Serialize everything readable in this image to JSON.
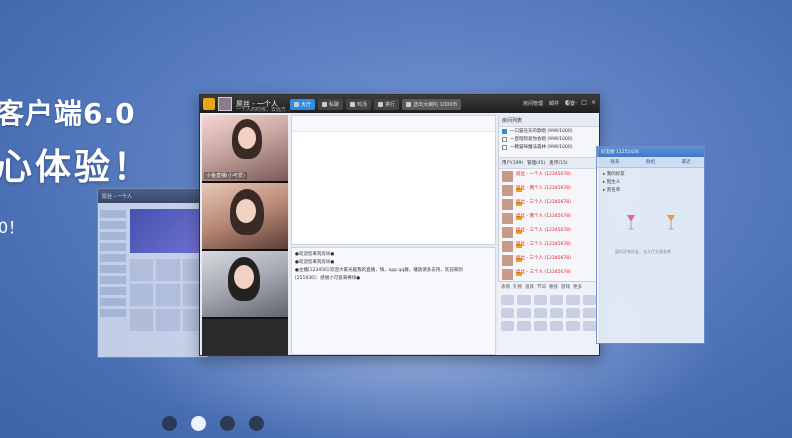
{
  "banner": {
    "headline": "客户端6.0",
    "sub_headline": "心体验！",
    "tagline": "0！"
  },
  "main_window": {
    "user_name": "屌丝 - 一个人",
    "user_desc": "一个人的时候，去远方...",
    "tabs": [
      {
        "label": "大厅",
        "active": true
      },
      {
        "label": "私聊",
        "active": false
      },
      {
        "label": "鸡汤",
        "active": false
      },
      {
        "label": "排行",
        "active": false
      },
      {
        "label": "送出大喇叭 1000币",
        "active": false
      }
    ],
    "top_links": [
      "房间管理",
      "邮件",
      "设置"
    ],
    "video_caption": "小鱼直播(小可爱)",
    "chat_log": [
      "●欢迎您来到房间●",
      "●欢迎您来到房间●",
      "●主播[123456]:欢迎大家光临我的直播，嗨，app qq群，播放请多支持，欢迎来到",
      "[251936]：感谢小可爱来捧场●"
    ],
    "song_list_title": "房间列表",
    "songs": [
      {
        "label": "一口猫任东的歌唱 (999/1000)",
        "checked": true
      },
      {
        "label": "一直暗暗爱你会唱 (999/1000)",
        "checked": false
      },
      {
        "label": "一颗猫咪魔法森林 (999/1000)",
        "checked": false
      }
    ],
    "user_list_tabs": [
      "用户(199)",
      "管理(45)",
      "麦序(15)"
    ],
    "users": [
      "屌丝 - 一个人 (12345678)",
      "屌丝 - 两个人 (12345678)",
      "屌丝 - 三个人 (12345678)",
      "屌丝 - 两个人 (12345678)",
      "屌丝 - 三个人 (12345678)",
      "屌丝 - 三个人 (12345678)",
      "屌丝 - 三个人 (12345678)",
      "屌丝 - 三个人 (12345678)"
    ],
    "emoji_tabs": [
      "表情",
      "礼物",
      "道具",
      "节日",
      "奢侈",
      "游戏",
      "更多"
    ]
  },
  "left_window": {
    "title": "屌丝 - 一个人"
  },
  "right_window": {
    "title": "好友圈 11255434",
    "tabs": [
      "联系",
      "群组",
      "最近"
    ],
    "groups": [
      "我的好友",
      "陌生人",
      "黑名单"
    ],
    "empty_message": "暂时没有好友，去大厅交朋友吧"
  },
  "carousel": {
    "count": 4,
    "active_index": 1
  },
  "colors": {
    "accent": "#2e8de0",
    "background": "#5f82c4"
  }
}
